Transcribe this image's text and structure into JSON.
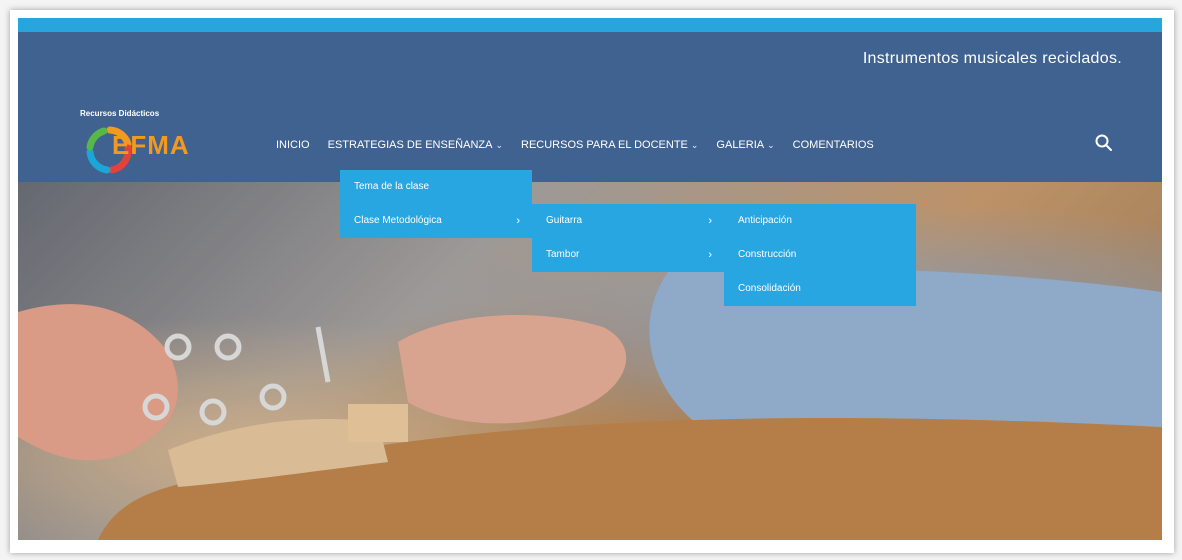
{
  "header": {
    "tagline": "Instrumentos musicales reciclados.",
    "logo_label": "Recursos Didácticos",
    "logo_text": "EFMA"
  },
  "nav": {
    "items": [
      {
        "label": "INICIO"
      },
      {
        "label": "ESTRATEGIAS DE ENSEÑANZA"
      },
      {
        "label": "RECURSOS PARA EL DOCENTE"
      },
      {
        "label": "GALERIA"
      },
      {
        "label": "COMENTARIOS"
      }
    ],
    "search_icon": "search-icon"
  },
  "dropdowns": {
    "level1": [
      {
        "label": "Tema de la clase"
      },
      {
        "label": "Clase Metodológica"
      }
    ],
    "level2": [
      {
        "label": "Guitarra"
      },
      {
        "label": "Tambor"
      }
    ],
    "level3": [
      {
        "label": "Anticipación"
      },
      {
        "label": "Construcción"
      },
      {
        "label": "Consolidación"
      }
    ]
  },
  "colors": {
    "header": "#3f6290",
    "accent": "#27a6e1",
    "logo_orange": "#f29a1f"
  }
}
